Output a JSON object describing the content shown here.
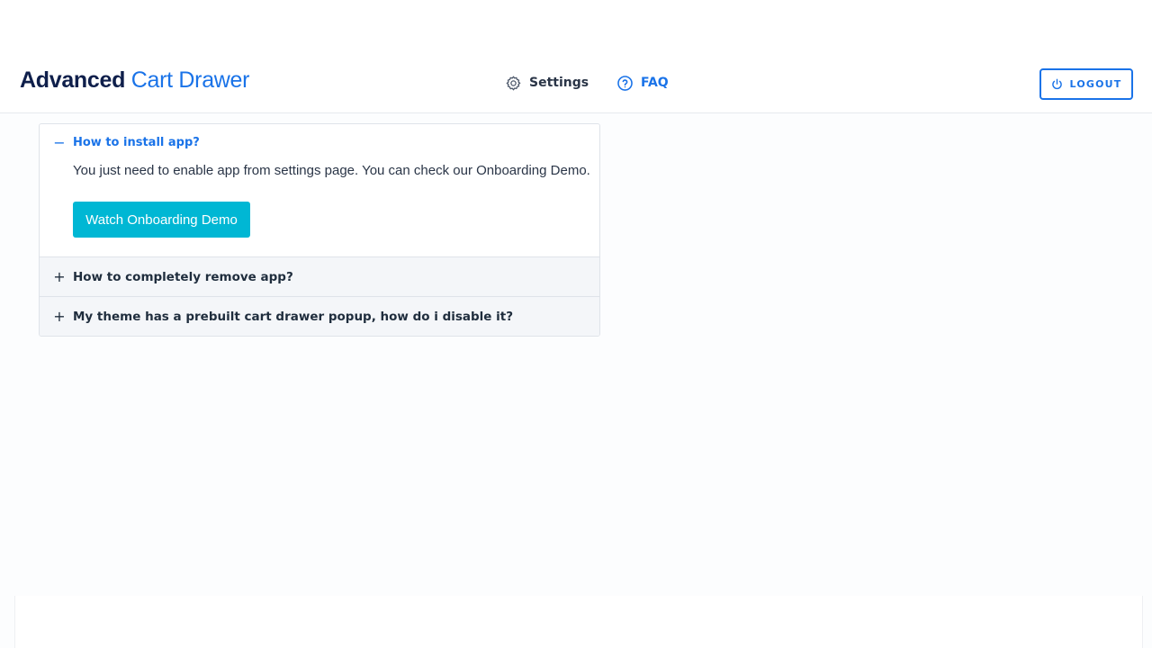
{
  "header": {
    "brand_bold": "Advanced",
    "brand_light": "Cart Drawer",
    "nav": {
      "settings_label": "Settings",
      "faq_label": "FAQ"
    },
    "logout_label": "LOGOUT"
  },
  "faq": {
    "items": [
      {
        "question": "How to install app?",
        "state": "expanded",
        "toggle": "−",
        "answer": "You just need to enable app from settings page. You can check our Onboarding Demo.",
        "button_label": "Watch Onboarding Demo"
      },
      {
        "question": "How to completely remove app?",
        "state": "collapsed",
        "toggle": "+"
      },
      {
        "question": "My theme has a prebuilt cart drawer popup, how do i disable it?",
        "state": "collapsed",
        "toggle": "+"
      }
    ]
  },
  "icons": {
    "settings": "gear-icon",
    "faq": "question-circle-icon",
    "logout": "power-icon"
  },
  "colors": {
    "accent": "#1a73e8",
    "brand_dark": "#0f1f4b",
    "button_cyan": "#00b7d4",
    "text": "#2a3547"
  }
}
